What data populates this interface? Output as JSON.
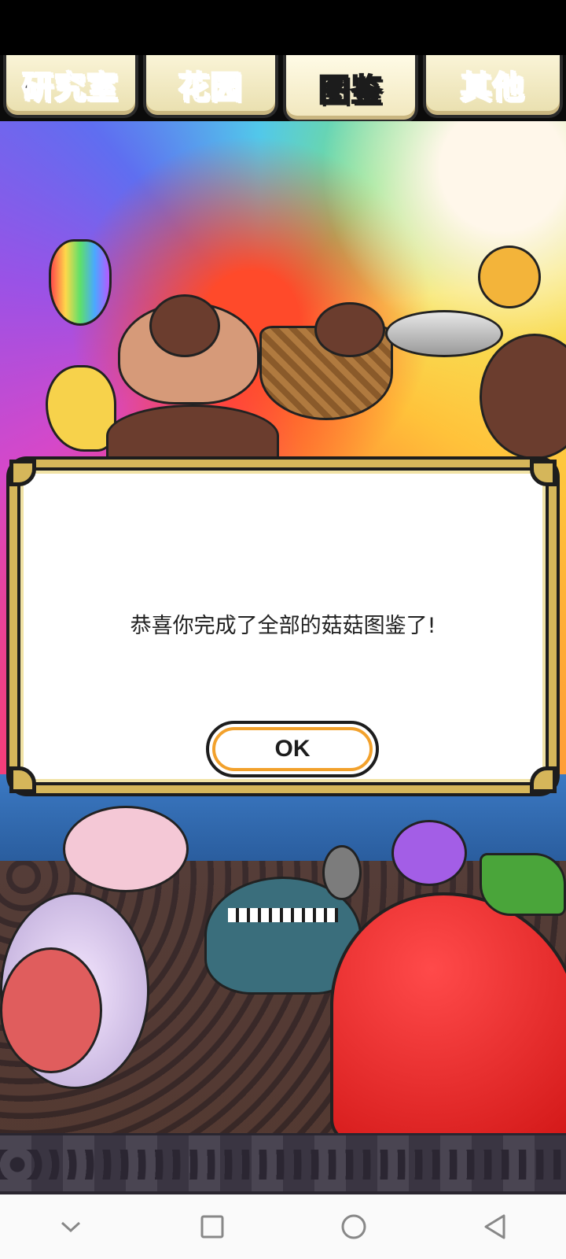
{
  "tabs": [
    {
      "label": "研究室",
      "active": false
    },
    {
      "label": "花园",
      "active": false
    },
    {
      "label": "图鉴",
      "active": true
    },
    {
      "label": "其他",
      "active": false
    }
  ],
  "dialog": {
    "message": "恭喜你完成了全部的菇菇图鉴了!",
    "ok_label": "OK"
  },
  "navigation": {
    "buttons": [
      "chevron-down-icon",
      "square-icon",
      "circle-icon",
      "triangle-back-icon"
    ]
  },
  "colors": {
    "tab_active_text": "#ffe51c",
    "dialog_gold": "#d5b65a",
    "ok_button_ring": "#f2a12c"
  }
}
